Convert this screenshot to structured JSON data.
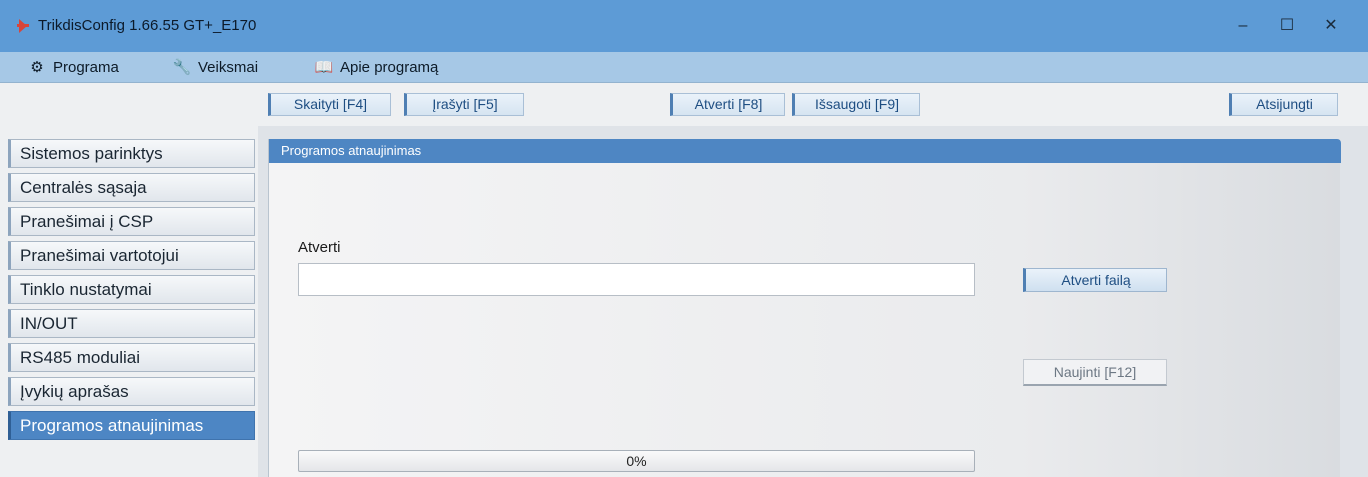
{
  "window": {
    "title": "TrikdisConfig 1.66.55   GT+_E170",
    "minimize_glyph": "–",
    "maximize_glyph": "☐",
    "close_glyph": "✕",
    "app_icon": "trikdis-app-icon"
  },
  "menu": {
    "items": [
      {
        "label": "Programa",
        "icon": "gear-icon",
        "glyph": "⚙"
      },
      {
        "label": "Veiksmai",
        "icon": "wrench-icon",
        "glyph": "🔧"
      },
      {
        "label": "Apie programą",
        "icon": "book-icon",
        "glyph": "📖"
      }
    ]
  },
  "toolbar": {
    "read_label": "Skaityti [F4]",
    "write_label": "Įrašyti [F5]",
    "open_label": "Atverti [F8]",
    "save_label": "Išsaugoti [F9]",
    "disconnect_label": "Atsijungti"
  },
  "sidebar": {
    "items": [
      {
        "label": "Sistemos parinktys"
      },
      {
        "label": "Centralės sąsaja"
      },
      {
        "label": "Pranešimai į CSP"
      },
      {
        "label": "Pranešimai vartotojui"
      },
      {
        "label": "Tinklo nustatymai"
      },
      {
        "label": "IN/OUT"
      },
      {
        "label": "RS485 moduliai"
      },
      {
        "label": "Įvykių aprašas"
      },
      {
        "label": "Programos atnaujinimas",
        "active": true
      }
    ]
  },
  "panel": {
    "title": "Programos atnaujinimas",
    "open_label": "Atverti",
    "file_value": "",
    "open_file_button": "Atverti failą",
    "update_button": "Naujinti [F12]",
    "progress": {
      "value": 0,
      "text": "0%"
    }
  },
  "colors": {
    "titlebar": "#5d9bd6",
    "menubar": "#a6c8e6",
    "accent": "#4e86c3",
    "progress_fill": "#6ec06e"
  }
}
